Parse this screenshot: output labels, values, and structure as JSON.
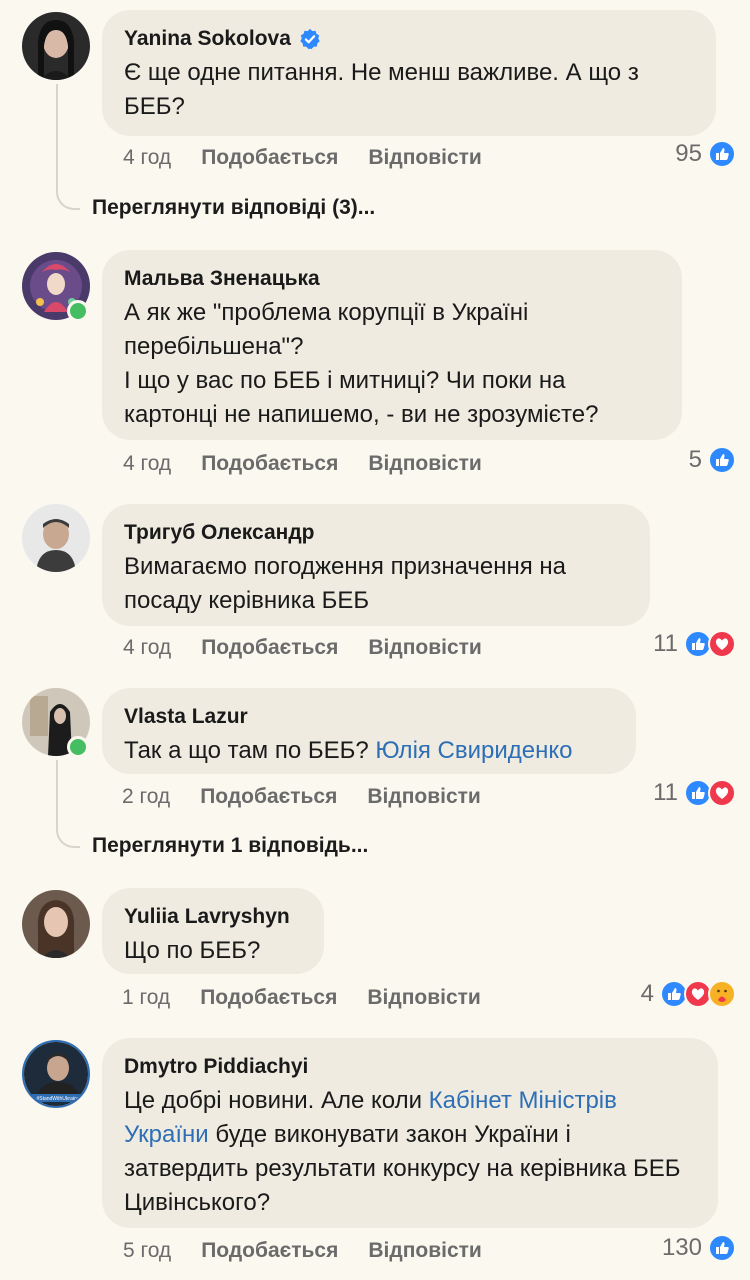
{
  "comments": [
    {
      "author": "Yanina Sokolova",
      "verified": true,
      "text": "Є ще одне питання. Не менш важливе. А що з БЕБ?",
      "time": "4 год",
      "like_label": "Подобається",
      "reply_label": "Відповісти",
      "reaction_count": "95",
      "reactions": [
        "like-icon"
      ],
      "more_replies": "Переглянути відповіді (3)..."
    },
    {
      "author": "Мальва Зненацька",
      "text": "А як же \"проблема корупції в Україні перебільшена\"?\nІ що у вас по БЕБ і митниці? Чи поки на картонці не напишемо, - ви не зрозумієте?",
      "time": "4 год",
      "like_label": "Подобається",
      "reply_label": "Відповісти",
      "reaction_count": "5",
      "reactions": [
        "like-icon"
      ]
    },
    {
      "author": "Тригуб Олександр",
      "text": "Вимагаємо погодження призначення на посаду керівника БЕБ",
      "time": "4 год",
      "like_label": "Подобається",
      "reply_label": "Відповісти",
      "reaction_count": "11",
      "reactions": [
        "like-icon",
        "love-icon"
      ]
    },
    {
      "author": "Vlasta Lazur",
      "text_prefix": "Так а що там по БЕБ? ",
      "mention": "Юлія Свириденко",
      "time": "2 год",
      "like_label": "Подобається",
      "reply_label": "Відповісти",
      "reaction_count": "11",
      "reactions": [
        "like-icon",
        "love-icon"
      ],
      "more_replies": "Переглянути 1 відповідь..."
    },
    {
      "author": "Yuliia Lavryshyn",
      "text": "Що по БЕБ?",
      "time": "1 год",
      "like_label": "Подобається",
      "reply_label": "Відповісти",
      "reaction_count": "4",
      "reactions": [
        "like-icon",
        "love-icon",
        "care-icon"
      ]
    },
    {
      "author": "Dmytro Piddiachyi",
      "text_prefix": "Це добрі новини. Але коли ",
      "mention": "Кабінет Міністрів України",
      "text_suffix": " буде виконувати закон України і затвердить результати конкурсу на керівника БЕБ Цивінського?",
      "time": "5 год",
      "like_label": "Подобається",
      "reply_label": "Відповісти",
      "reaction_count": "130",
      "reactions": [
        "like-icon"
      ],
      "avatar_caption": "#StandWithUkraine"
    }
  ],
  "colors": {
    "background": "#fbf8f0",
    "bubble": "#efebe1",
    "mention": "#2d6fb6",
    "like_blue": "#2e89ff",
    "love_red": "#f0384c",
    "online_green": "#45bd62"
  }
}
